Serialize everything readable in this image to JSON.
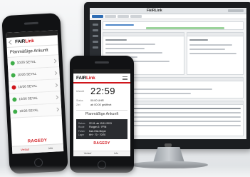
{
  "brand": {
    "name_prefix": "FAIR",
    "name_suffix": "Link",
    "manufacturer": "RAGEDY",
    "accent_color": "#d0161c"
  },
  "desktop": {
    "brand": "FAIRLink"
  },
  "left_phone": {
    "logo": "FAIRLink",
    "title": "Planmäßige Ankunft",
    "rows": [
      {
        "status": "ok",
        "value": "10/26 SEYAL"
      },
      {
        "status": "ok",
        "value": "10/26 SEYAL"
      },
      {
        "status": "alert",
        "value": "10/26 SEYAL"
      },
      {
        "status": "ok",
        "value": "10/26 SEYAL"
      },
      {
        "status": "ok",
        "value": "10/26 SEYAL"
      }
    ],
    "footer_brand": "RAGEDY",
    "nav": [
      "Verlauf",
      "Info"
    ]
  },
  "right_phone": {
    "logo": "FAIRLink",
    "time_label": "Uhrzeit",
    "time": "22:59",
    "fields": [
      {
        "key": "Status",
        "value": "00:00 UHR"
      },
      {
        "key": "Ziel",
        "value": "ab 00:00 geöffnet"
      }
    ],
    "banner": "Planmäßige Ankunft",
    "card": [
      {
        "key": "Datum",
        "value": "22.01. ab 19:11.2013"
      },
      {
        "key": "Route",
        "value": "Florgen 3 · FFM"
      },
      {
        "key": "Fahrer",
        "value": "Karl-Otto Meyer"
      },
      {
        "key": "Lager",
        "value": "HH · 70 · 70/70"
      }
    ],
    "footer_brand": "RAGEDY",
    "nav": [
      "Verlauf",
      "Info"
    ]
  }
}
